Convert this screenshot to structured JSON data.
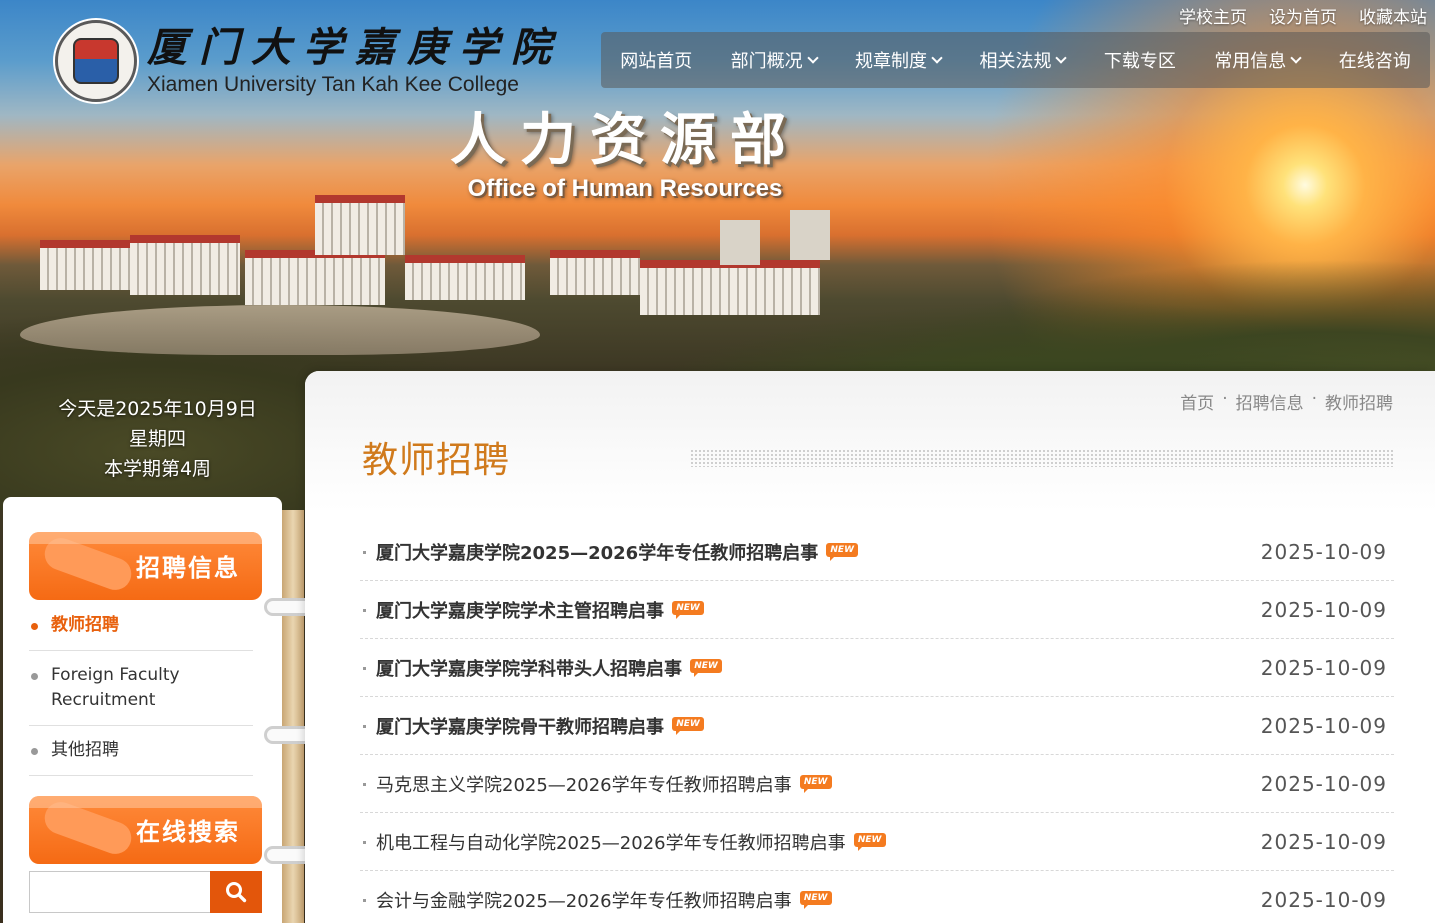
{
  "header": {
    "college_cn": "厦门大学嘉庚学院",
    "college_en": "Xiamen University Tan Kah Kee College",
    "dept_cn": "人力资源部",
    "dept_en": "Office of Human Resources",
    "top_links": [
      "学校主页",
      "设为首页",
      "收藏本站"
    ]
  },
  "nav": {
    "items": [
      {
        "label": "网站首页",
        "has_dropdown": false
      },
      {
        "label": "部门概况",
        "has_dropdown": true
      },
      {
        "label": "规章制度",
        "has_dropdown": true
      },
      {
        "label": "相关法规",
        "has_dropdown": true
      },
      {
        "label": "下载专区",
        "has_dropdown": false
      },
      {
        "label": "常用信息",
        "has_dropdown": true
      },
      {
        "label": "在线咨询",
        "has_dropdown": false
      }
    ]
  },
  "date_info": {
    "today": "今天是2025年10月9日",
    "weekday": "星期四",
    "week": "本学期第4周"
  },
  "sidebar": {
    "section_title": "招聘信息",
    "items": [
      {
        "label": "教师招聘",
        "active": true
      },
      {
        "label": "Foreign Faculty Recruitment",
        "active": false
      },
      {
        "label": "其他招聘",
        "active": false
      }
    ],
    "search_title": "在线搜索",
    "search_value": ""
  },
  "main": {
    "breadcrumb": [
      "首页",
      "招聘信息",
      "教师招聘"
    ],
    "title": "教师招聘",
    "new_badge": "NEW",
    "news": [
      {
        "title": "厦门大学嘉庚学院2025—2026学年专任教师招聘启事",
        "date": "2025-10-09",
        "bold": true
      },
      {
        "title": "厦门大学嘉庚学院学术主管招聘启事",
        "date": "2025-10-09",
        "bold": true
      },
      {
        "title": "厦门大学嘉庚学院学科带头人招聘启事",
        "date": "2025-10-09",
        "bold": true
      },
      {
        "title": "厦门大学嘉庚学院骨干教师招聘启事",
        "date": "2025-10-09",
        "bold": true
      },
      {
        "title": "马克思主义学院2025—2026学年专任教师招聘启事",
        "date": "2025-10-09",
        "bold": false
      },
      {
        "title": "机电工程与自动化学院2025—2026学年专任教师招聘启事",
        "date": "2025-10-09",
        "bold": false
      },
      {
        "title": "会计与金融学院2025—2026学年专任教师招聘启事",
        "date": "2025-10-09",
        "bold": false
      }
    ]
  },
  "colors": {
    "accent_orange": "#e8600d",
    "title_orange": "#d07a1c",
    "new_badge": "#f47b20"
  }
}
